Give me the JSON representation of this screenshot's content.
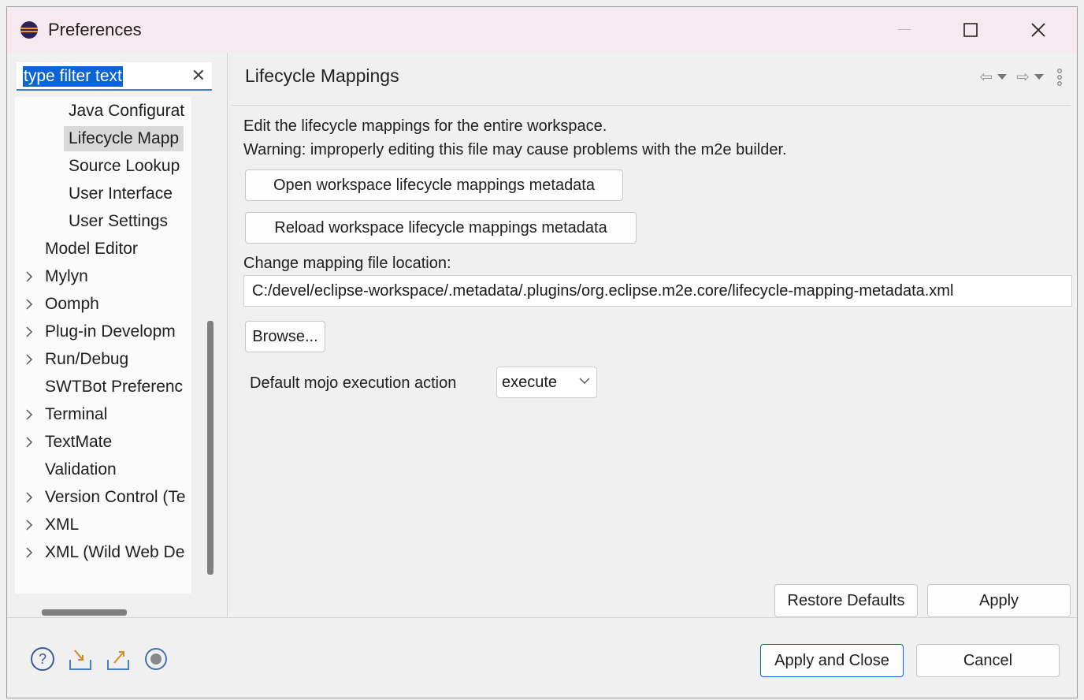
{
  "window": {
    "title": "Preferences"
  },
  "filter": {
    "text": "type filter text"
  },
  "tree": [
    {
      "label": "Java Configurat",
      "level": 2,
      "expandable": false,
      "selected": false
    },
    {
      "label": "Lifecycle Mapp",
      "level": 2,
      "expandable": false,
      "selected": true
    },
    {
      "label": "Source Lookup",
      "level": 2,
      "expandable": false,
      "selected": false
    },
    {
      "label": "User Interface",
      "level": 2,
      "expandable": false,
      "selected": false
    },
    {
      "label": "User Settings",
      "level": 2,
      "expandable": false,
      "selected": false
    },
    {
      "label": "Model Editor",
      "level": 1,
      "expandable": false,
      "selected": false
    },
    {
      "label": "Mylyn",
      "level": 1,
      "expandable": true,
      "selected": false
    },
    {
      "label": "Oomph",
      "level": 1,
      "expandable": true,
      "selected": false
    },
    {
      "label": "Plug-in Developm",
      "level": 1,
      "expandable": true,
      "selected": false
    },
    {
      "label": "Run/Debug",
      "level": 1,
      "expandable": true,
      "selected": false
    },
    {
      "label": "SWTBot Preferenc",
      "level": 1,
      "expandable": false,
      "selected": false
    },
    {
      "label": "Terminal",
      "level": 1,
      "expandable": true,
      "selected": false
    },
    {
      "label": "TextMate",
      "level": 1,
      "expandable": true,
      "selected": false
    },
    {
      "label": "Validation",
      "level": 1,
      "expandable": false,
      "selected": false
    },
    {
      "label": "Version Control (Te",
      "level": 1,
      "expandable": true,
      "selected": false
    },
    {
      "label": "XML",
      "level": 1,
      "expandable": true,
      "selected": false
    },
    {
      "label": "XML (Wild Web De",
      "level": 1,
      "expandable": true,
      "selected": false
    }
  ],
  "page": {
    "title": "Lifecycle Mappings",
    "desc1": "Edit the lifecycle mappings for the entire workspace.",
    "desc2": "Warning: improperly editing this file may cause problems with the m2e builder.",
    "open_btn": "Open workspace lifecycle mappings metadata",
    "reload_btn": "Reload workspace lifecycle mappings metadata",
    "change_label": "Change mapping file location:",
    "file_path": "C:/devel/eclipse-workspace/.metadata/.plugins/org.eclipse.m2e.core/lifecycle-mapping-metadata.xml",
    "browse_btn": "Browse...",
    "mojo_label": "Default mojo execution action",
    "mojo_value": "execute",
    "restore_btn": "Restore Defaults",
    "apply_btn": "Apply"
  },
  "footer": {
    "apply_close_btn": "Apply and Close",
    "cancel_btn": "Cancel"
  },
  "colors": {
    "accent": "#0a64d6",
    "titlebar": "#f6eaf0",
    "selection": "#d9d9d9"
  }
}
